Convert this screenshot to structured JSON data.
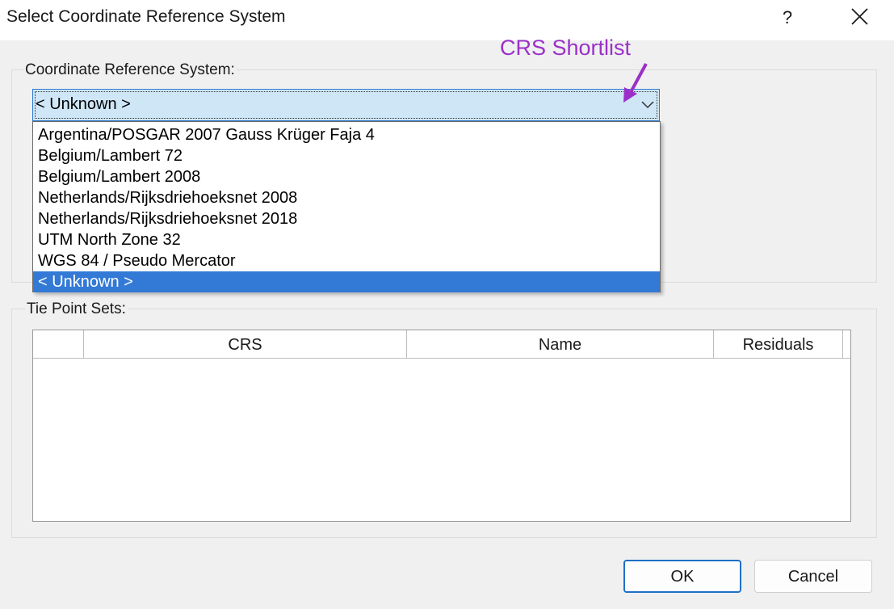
{
  "window": {
    "title": "Select Coordinate Reference System",
    "help_label": "?"
  },
  "crs_group": {
    "label": "Coordinate Reference System:",
    "combo_value": "< Unknown >",
    "options": [
      "Argentina/POSGAR 2007 Gauss Krüger Faja 4",
      "Belgium/Lambert 72",
      "Belgium/Lambert 2008",
      "Netherlands/Rijksdriehoeksnet 2008",
      "Netherlands/Rijksdriehoeksnet 2018",
      "UTM North Zone 32",
      "WGS 84 / Pseudo Mercator",
      "< Unknown >"
    ],
    "selected_index": 7
  },
  "annotation": {
    "text": "CRS Shortlist",
    "color": "#9b30c9"
  },
  "tie_points": {
    "label": "Tie Point Sets:",
    "columns": [
      "",
      "CRS",
      "Name",
      "Residuals"
    ],
    "rows": []
  },
  "buttons": {
    "ok": "OK",
    "cancel": "Cancel"
  },
  "colors": {
    "selection": "#3379d6",
    "focus": "#1e6fc7"
  }
}
